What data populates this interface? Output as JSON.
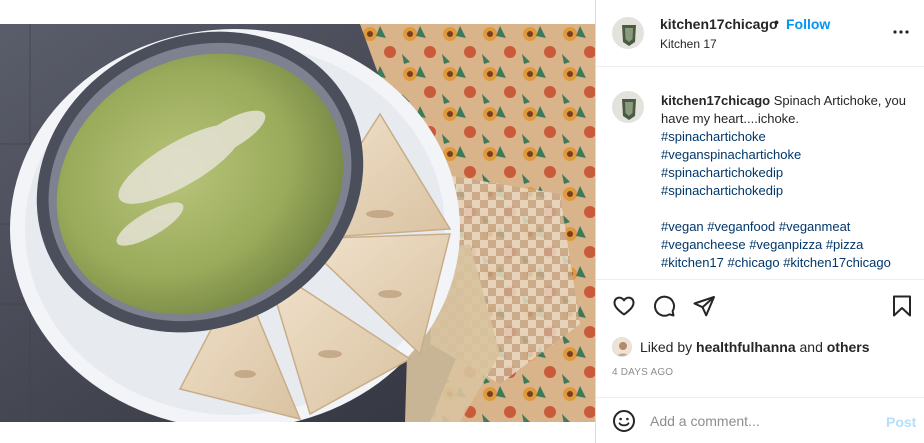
{
  "post": {
    "image_alt": "Spinach artichoke dip in an oval dish with pita wedges on a plate",
    "author": {
      "username": "kitchen17chicago",
      "location": "Kitchen 17",
      "follow_label": "Follow",
      "separator": "•",
      "avatar_icon": "avatar-logo-icon"
    },
    "caption": {
      "username": "kitchen17chicago",
      "text": "Spinach Artichoke, you have my heart....ichoke.",
      "hashtag_lines": [
        "#spinachartichoke",
        "#veganspinachartichoke",
        "#spinachartichokedip",
        "#spinachartichokedip"
      ],
      "hashtag_group": [
        "#vegan",
        "#veganfood",
        "#veganmeat",
        "#vegancheese",
        "#veganpizza",
        "#pizza",
        "#kitchen17",
        "#chicago",
        "#kitchen17chicago"
      ]
    },
    "actions": [
      "heart-icon",
      "comment-icon",
      "share-icon",
      "bookmark-icon"
    ],
    "likes": {
      "prefix": "Liked by",
      "user": "healthfulhanna",
      "and": "and",
      "others": "others"
    },
    "timestamp": "4 DAYS AGO",
    "comment_box": {
      "placeholder": "Add a comment...",
      "post_label": "Post",
      "emoji_icon": "smiley-icon"
    }
  },
  "colors": {
    "accent": "#0095f6",
    "link": "#00376b",
    "muted": "#8e8e8e",
    "post_disabled": "#b2dffc"
  }
}
